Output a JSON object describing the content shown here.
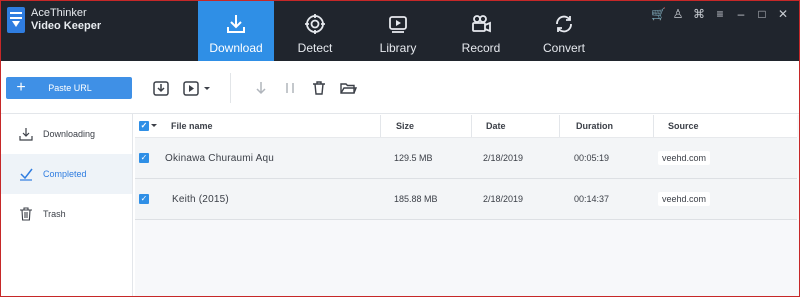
{
  "app": {
    "name_line1": "AceThinker",
    "name_line2": "Video Keeper"
  },
  "nav": {
    "tabs": [
      {
        "label": "Download",
        "active": true
      },
      {
        "label": "Detect",
        "active": false
      },
      {
        "label": "Library",
        "active": false
      },
      {
        "label": "Record",
        "active": false
      },
      {
        "label": "Convert",
        "active": false
      }
    ]
  },
  "toolbar": {
    "paste_url_label": "Paste URL"
  },
  "sidebar": {
    "items": [
      {
        "label": "Downloading",
        "icon": "download-icon",
        "active": false
      },
      {
        "label": "Completed",
        "icon": "check-icon",
        "active": true
      },
      {
        "label": "Trash",
        "icon": "trash-icon",
        "active": false
      }
    ]
  },
  "table": {
    "columns": [
      "File name",
      "Size",
      "Date",
      "Duration",
      "Source"
    ],
    "rows": [
      {
        "name": "Okinawa Churaumi Aqu",
        "size": "129.5 MB",
        "date": "2/18/2019",
        "duration": "00:05:19",
        "source": "veehd.com",
        "checked": true
      },
      {
        "name": "Keith (2015)",
        "size": "185.88 MB",
        "date": "2/18/2019",
        "duration": "00:14:37",
        "source": "veehd.com",
        "checked": true
      }
    ]
  },
  "colors": {
    "accent": "#2f8fe6",
    "topbar": "#20252d",
    "border": "#c62828"
  }
}
